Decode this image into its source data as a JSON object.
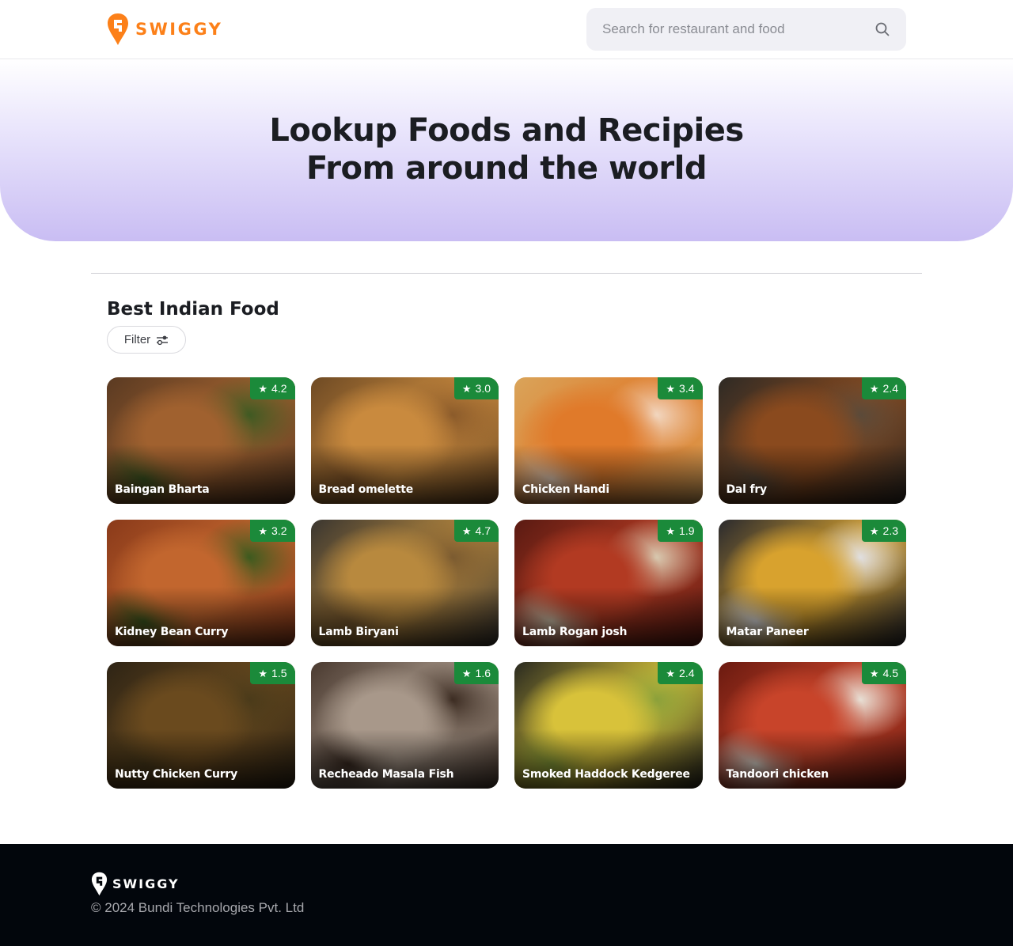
{
  "header": {
    "logo_text": "SWIGGY",
    "search_placeholder": "Search for restaurant and food",
    "search_icon": "search-icon"
  },
  "hero": {
    "line1": "Lookup Foods and Recipies",
    "line2": "From around the world"
  },
  "section": {
    "title": "Best Indian Food",
    "filter_label": "Filter",
    "filter_icon": "sliders-icon"
  },
  "foods": [
    {
      "name": "Baingan Bharta",
      "rating": "4.2",
      "colors": [
        "#5a3a22",
        "#a0612f",
        "#3d5a22"
      ]
    },
    {
      "name": "Bread omelette",
      "rating": "3.0",
      "colors": [
        "#6e4a24",
        "#c98a3e",
        "#8a5a2a"
      ]
    },
    {
      "name": "Chicken Handi",
      "rating": "3.4",
      "colors": [
        "#d9a45a",
        "#e07a2a",
        "#f2d8c2"
      ]
    },
    {
      "name": "Dal fry",
      "rating": "2.4",
      "colors": [
        "#2e2a25",
        "#8a4a1e",
        "#5a4a3a"
      ]
    },
    {
      "name": "Kidney Bean Curry",
      "rating": "3.2",
      "colors": [
        "#8a3a1a",
        "#c2662e",
        "#3a5a1e"
      ]
    },
    {
      "name": "Lamb Biryani",
      "rating": "4.7",
      "colors": [
        "#3a3630",
        "#b8893e",
        "#7a5a30"
      ]
    },
    {
      "name": "Lamb Rogan josh",
      "rating": "1.9",
      "colors": [
        "#5a1a12",
        "#b23a22",
        "#d8cbb2"
      ]
    },
    {
      "name": "Matar Paneer",
      "rating": "2.3",
      "colors": [
        "#2a2a2e",
        "#d8a22e",
        "#e0e0e4"
      ]
    },
    {
      "name": "Nutty Chicken Curry",
      "rating": "1.5",
      "colors": [
        "#2e2415",
        "#6a4a1e",
        "#4a3a1a"
      ]
    },
    {
      "name": "Recheado Masala Fish",
      "rating": "1.6",
      "colors": [
        "#4a3a30",
        "#a8988a",
        "#3a2a20"
      ]
    },
    {
      "name": "Smoked Haddock Kedgeree",
      "rating": "2.4",
      "colors": [
        "#2a2a20",
        "#d8c23a",
        "#8aa03a"
      ]
    },
    {
      "name": "Tandoori chicken",
      "rating": "4.5",
      "colors": [
        "#6a1a10",
        "#c8442a",
        "#e8e2d8"
      ]
    }
  ],
  "footer": {
    "logo_text": "SWIGGY",
    "copyright": "© 2024 Bundi Technologies Pvt. Ltd"
  },
  "colors": {
    "brand": "#fc8019",
    "rating_badge": "#1b8a3a",
    "footer_bg": "#02060c",
    "hero_bottom": "#c9bdf3"
  }
}
